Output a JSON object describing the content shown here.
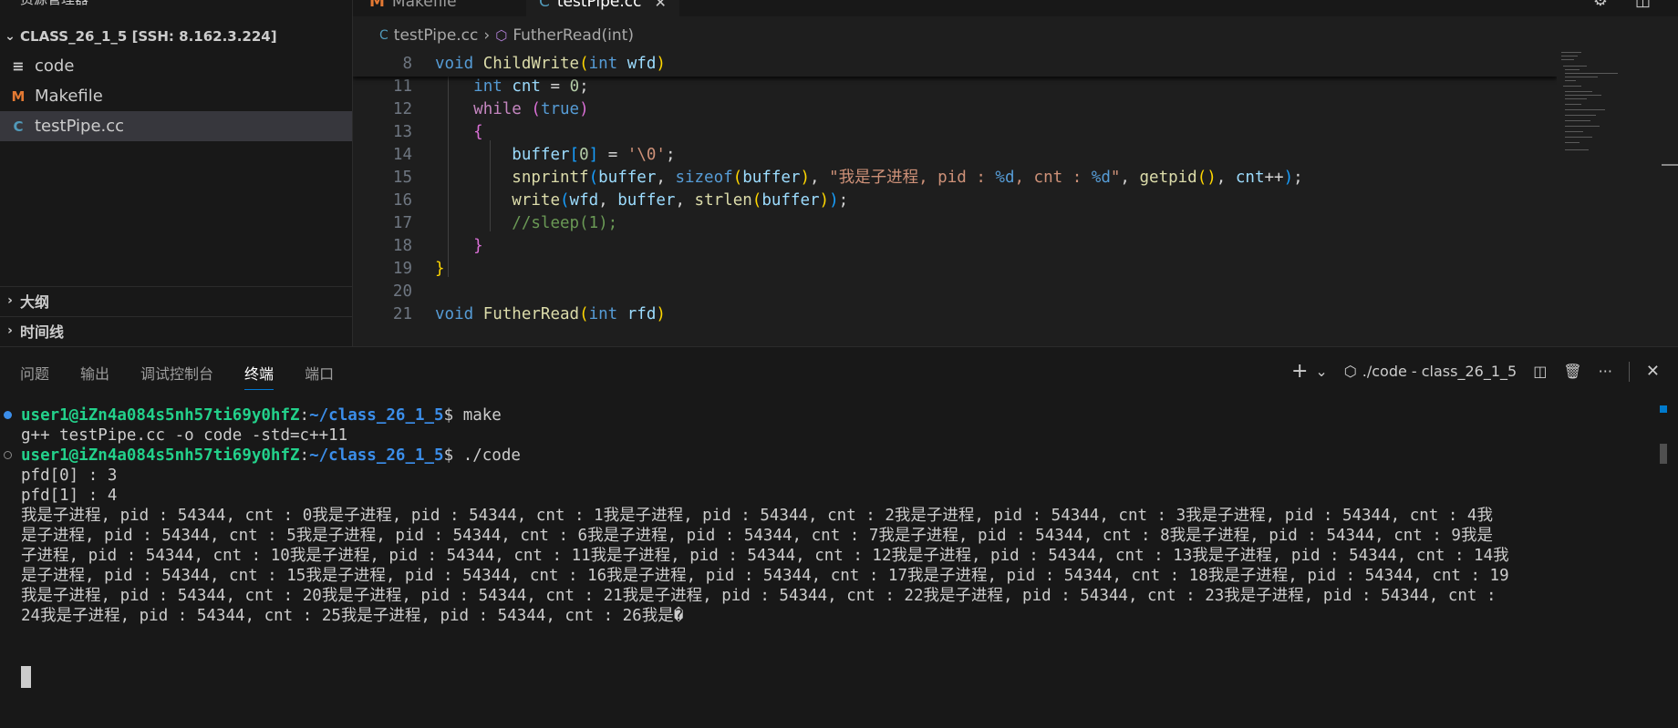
{
  "sidebar": {
    "title": "资源管理器",
    "folder": "CLASS_26_1_5 [SSH: 8.162.3.224]",
    "files": [
      {
        "name": "code",
        "icon": "lines-icon"
      },
      {
        "name": "Makefile",
        "icon": "M"
      },
      {
        "name": "testPipe.cc",
        "icon": "C"
      }
    ],
    "sections": [
      "大纲",
      "时间线"
    ]
  },
  "tabs": [
    {
      "label": "Makefile"
    },
    {
      "label": "testPipe.cc"
    }
  ],
  "breadcrumb": {
    "file": "testPipe.cc",
    "symbol": "FutherRead(int)"
  },
  "editor": {
    "sticky_line_number": "8",
    "line_numbers": [
      "11",
      "12",
      "13",
      "14",
      "15",
      "16",
      "17",
      "18",
      "19",
      "20",
      "21"
    ],
    "lines": [
      "void ChildWrite(int wfd)",
      "    int cnt = 0;",
      "    while (true)",
      "    {",
      "        buffer[0] = '\\0';",
      "        snprintf(buffer, sizeof(buffer), \"我是子进程, pid : %d, cnt : %d\", getpid(), cnt++);",
      "        write(wfd, buffer, strlen(buffer));",
      "        //sleep(1);",
      "    }",
      "}",
      "",
      "void FutherRead(int rfd)"
    ]
  },
  "panel": {
    "tabs": [
      "问题",
      "输出",
      "调试控制台",
      "终端",
      "端口"
    ],
    "active_tab": "终端",
    "terminal_name": "./code - class_26_1_5",
    "prompt_user": "user1@iZn4a084s5nh57ti69y0hfZ",
    "prompt_path": "~/class_26_1_5",
    "cmd1": "make",
    "cmd2": "./code",
    "output": [
      "g++ testPipe.cc -o code -std=c++11",
      "pfd[0] : 3",
      "pfd[1] : 4",
      "我是子进程, pid : 54344, cnt : 0我是子进程, pid : 54344, cnt : 1我是子进程, pid : 54344, cnt : 2我是子进程, pid : 54344, cnt : 3我是子进程, pid : 54344, cnt : 4我",
      "是子进程, pid : 54344, cnt : 5我是子进程, pid : 54344, cnt : 6我是子进程, pid : 54344, cnt : 7我是子进程, pid : 54344, cnt : 8我是子进程, pid : 54344, cnt : 9我是",
      "子进程, pid : 54344, cnt : 10我是子进程, pid : 54344, cnt : 11我是子进程, pid : 54344, cnt : 12我是子进程, pid : 54344, cnt : 13我是子进程, pid : 54344, cnt : 14我",
      "是子进程, pid : 54344, cnt : 15我是子进程, pid : 54344, cnt : 16我是子进程, pid : 54344, cnt : 17我是子进程, pid : 54344, cnt : 18我是子进程, pid : 54344, cnt : 19",
      "我是子进程, pid : 54344, cnt : 20我是子进程, pid : 54344, cnt : 21我是子进程, pid : 54344, cnt : 22我是子进程, pid : 54344, cnt : 23我是子进程, pid : 54344, cnt :",
      "24我是子进程, pid : 54344, cnt : 25我是子进程, pid : 54344, cnt : 26我是�"
    ]
  },
  "colors": {
    "accent": "#0078d4",
    "user": "#23d18b",
    "path": "#3b8eea"
  }
}
